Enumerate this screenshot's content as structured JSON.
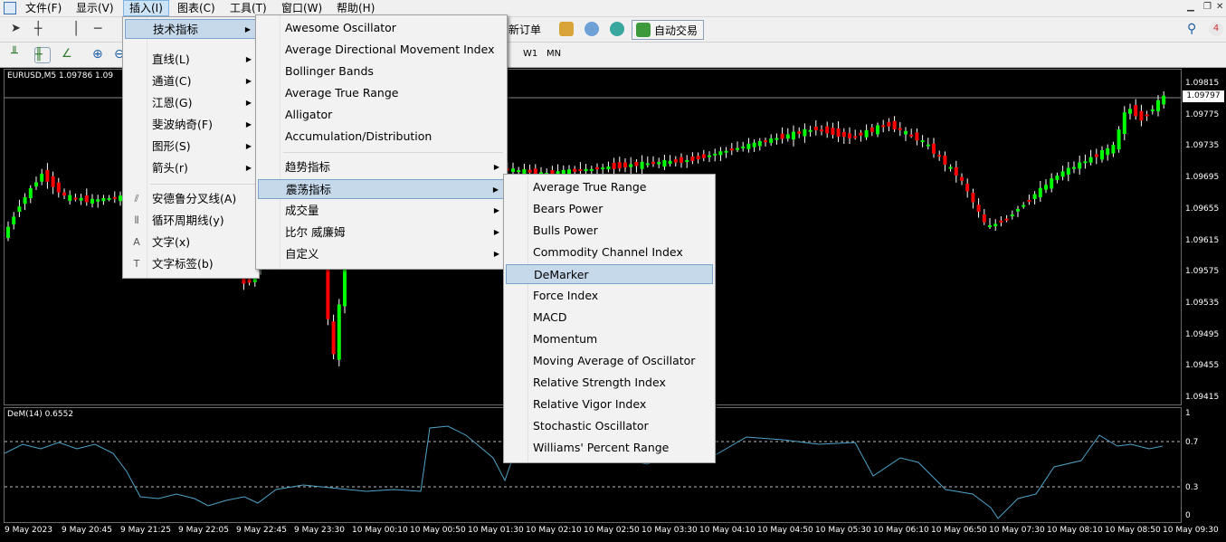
{
  "menubar": {
    "items": [
      "文件(F)",
      "显示(V)",
      "插入(I)",
      "图表(C)",
      "工具(T)",
      "窗口(W)",
      "帮助(H)"
    ]
  },
  "toolbar": {
    "new_order": "新订单",
    "auto_trading": "自动交易",
    "timeframes": [
      "W1",
      "MN"
    ]
  },
  "insert_menu": {
    "items": [
      {
        "label": "技术指标",
        "submenu": true
      },
      {
        "label": "直线(L)",
        "submenu": true
      },
      {
        "label": "通道(C)",
        "submenu": true
      },
      {
        "label": "江恩(G)",
        "submenu": true
      },
      {
        "label": "斐波纳奇(F)",
        "submenu": true
      },
      {
        "label": "图形(S)",
        "submenu": true
      },
      {
        "label": "箭头(r)",
        "submenu": true
      },
      {
        "label": "安德鲁分叉线(A)",
        "icon": "pitchfork-icon"
      },
      {
        "label": "循环周期线(y)",
        "icon": "cycle-lines-icon"
      },
      {
        "label": "文字(x)",
        "icon": "text-icon"
      },
      {
        "label": "文字标签(b)",
        "icon": "text-label-icon"
      }
    ]
  },
  "indicators_menu": {
    "items": [
      "Awesome Oscillator",
      "Average Directional Movement Index",
      "Bollinger Bands",
      "Average True Range",
      "Alligator",
      "Accumulation/Distribution"
    ],
    "categories": [
      "趋势指标",
      "震荡指标",
      "成交量",
      "比尔 威廉姆",
      "自定义"
    ]
  },
  "oscillators_menu": {
    "items": [
      "Average True Range",
      "Bears Power",
      "Bulls Power",
      "Commodity Channel Index",
      "DeMarker",
      "Force Index",
      "MACD",
      "Momentum",
      "Moving Average of Oscillator",
      "Relative Strength Index",
      "Relative Vigor Index",
      "Stochastic Oscillator",
      "Williams' Percent Range"
    ],
    "highlighted": "DeMarker"
  },
  "chart": {
    "title": "EURUSD,M5  1.09786 1.09",
    "current_price": "1.09797",
    "price_labels": [
      "1.09815",
      "1.09775",
      "1.09735",
      "1.09695",
      "1.09655",
      "1.09615",
      "1.09575",
      "1.09535",
      "1.09495",
      "1.09455",
      "1.09415"
    ],
    "bull_color": "#00ff00",
    "bear_color": "#ff0000"
  },
  "indicator": {
    "title": "DeM(14) 0.6552",
    "axis_labels": [
      "1",
      "0.7",
      "0.3",
      "0"
    ],
    "line_color": "#4fa3c8"
  },
  "time_axis": {
    "labels": [
      "9 May 2023",
      "9 May 20:45",
      "9 May 21:25",
      "9 May 22:05",
      "9 May 22:45",
      "9 May 23:30",
      "10 May 00:10",
      "10 May 00:50",
      "10 May 01:30",
      "10 May 02:10",
      "10 May 02:50",
      "10 May 03:30",
      "10 May 04:10",
      "10 May 04:50",
      "10 May 05:30",
      "10 May 06:10",
      "10 May 06:50",
      "10 May 07:30",
      "10 May 08:10",
      "10 May 08:50",
      "10 May 09:30"
    ]
  }
}
